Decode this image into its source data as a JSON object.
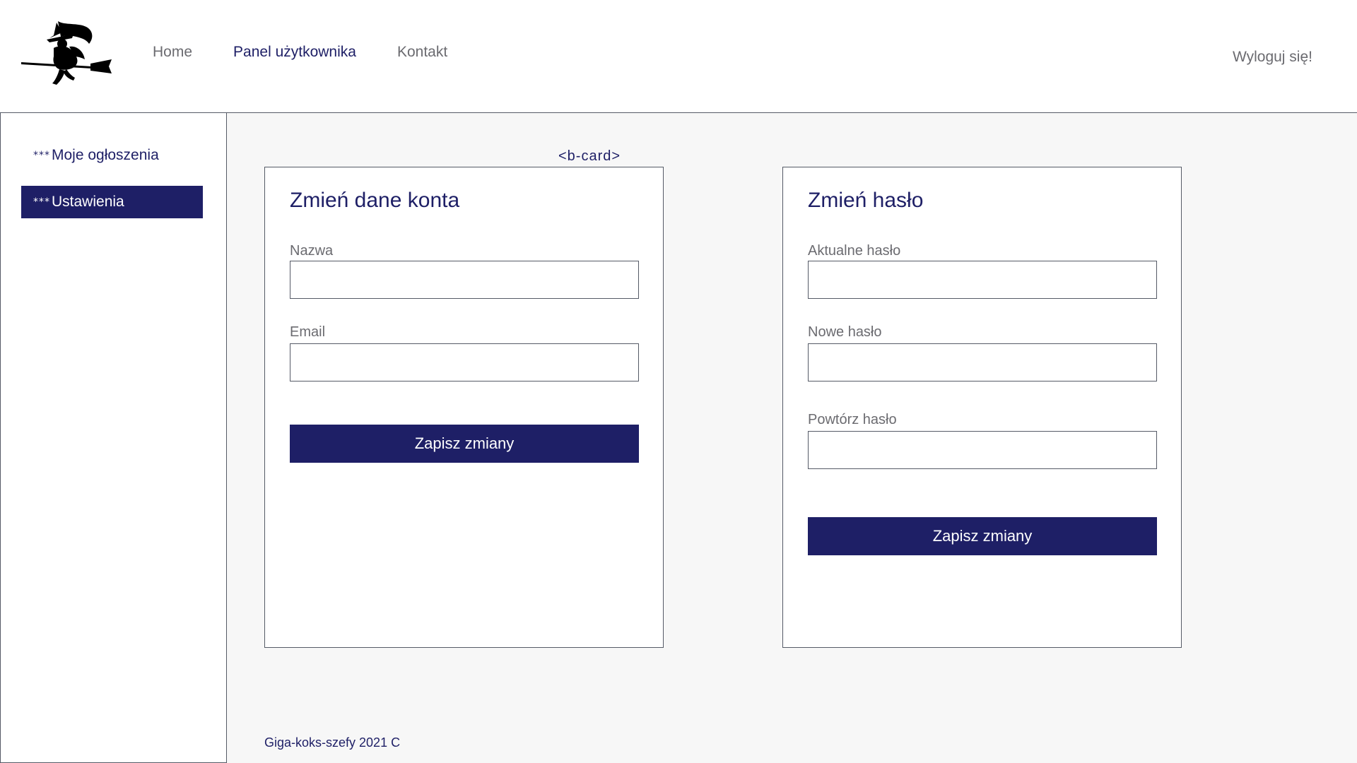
{
  "header": {
    "logo_icon": "witch-on-broom-icon",
    "nav": [
      {
        "label": "Home",
        "active": false
      },
      {
        "label": "Panel użytkownika",
        "active": true
      },
      {
        "label": "Kontakt",
        "active": false
      }
    ],
    "logout_label": "Wyloguj się!"
  },
  "sidebar": {
    "items": [
      {
        "marker": "***",
        "label": "Moje ogłoszenia",
        "active": false
      },
      {
        "marker": "***",
        "label": "Ustawienia",
        "active": true
      }
    ]
  },
  "main": {
    "component_tag": "<b-card>",
    "account_card": {
      "title": "Zmień dane konta",
      "fields": [
        {
          "label": "Nazwa",
          "value": ""
        },
        {
          "label": "Email",
          "value": ""
        }
      ],
      "save_label": "Zapisz zmiany"
    },
    "password_card": {
      "title": "Zmień hasło",
      "fields": [
        {
          "label": "Aktualne hasło",
          "value": ""
        },
        {
          "label": "Nowe hasło",
          "value": ""
        },
        {
          "label": "Powtórz hasło",
          "value": ""
        }
      ],
      "save_label": "Zapisz zmiany"
    },
    "footer_text": "Giga-koks-szefy 2021 C"
  },
  "colors": {
    "accent": "#1e1f66",
    "muted_text": "#6b6b70",
    "border": "#555a66",
    "content_bg": "#f7f7f7"
  }
}
